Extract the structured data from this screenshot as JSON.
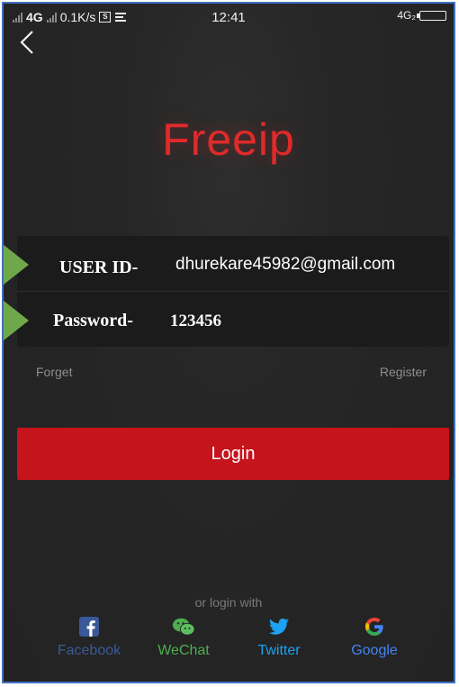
{
  "status_bar": {
    "network_left": "4G",
    "speed": "0.1K/s",
    "sim_icon": "S",
    "time": "12:41",
    "network_right": "4G₂"
  },
  "header": {
    "back_icon": "chevron-left-icon"
  },
  "logo": {
    "text": "Freeip",
    "color": "#e12a2a"
  },
  "form": {
    "user_label": "USER ID-",
    "user_value": "dhurekare45982@gmail.com",
    "password_label": "Password-",
    "password_value": "123456"
  },
  "links": {
    "forget": "Forget",
    "register": "Register"
  },
  "login_button": {
    "label": "Login",
    "color": "#c5141c"
  },
  "social": {
    "heading": "or login with",
    "items": [
      {
        "label": "Facebook",
        "icon": "facebook-icon",
        "color": "#3b5998"
      },
      {
        "label": "WeChat",
        "icon": "wechat-icon",
        "color": "#4caf50"
      },
      {
        "label": "Twitter",
        "icon": "twitter-icon",
        "color": "#1da1f2"
      },
      {
        "label": "Google",
        "icon": "google-icon",
        "color": "#ea4335"
      }
    ]
  }
}
